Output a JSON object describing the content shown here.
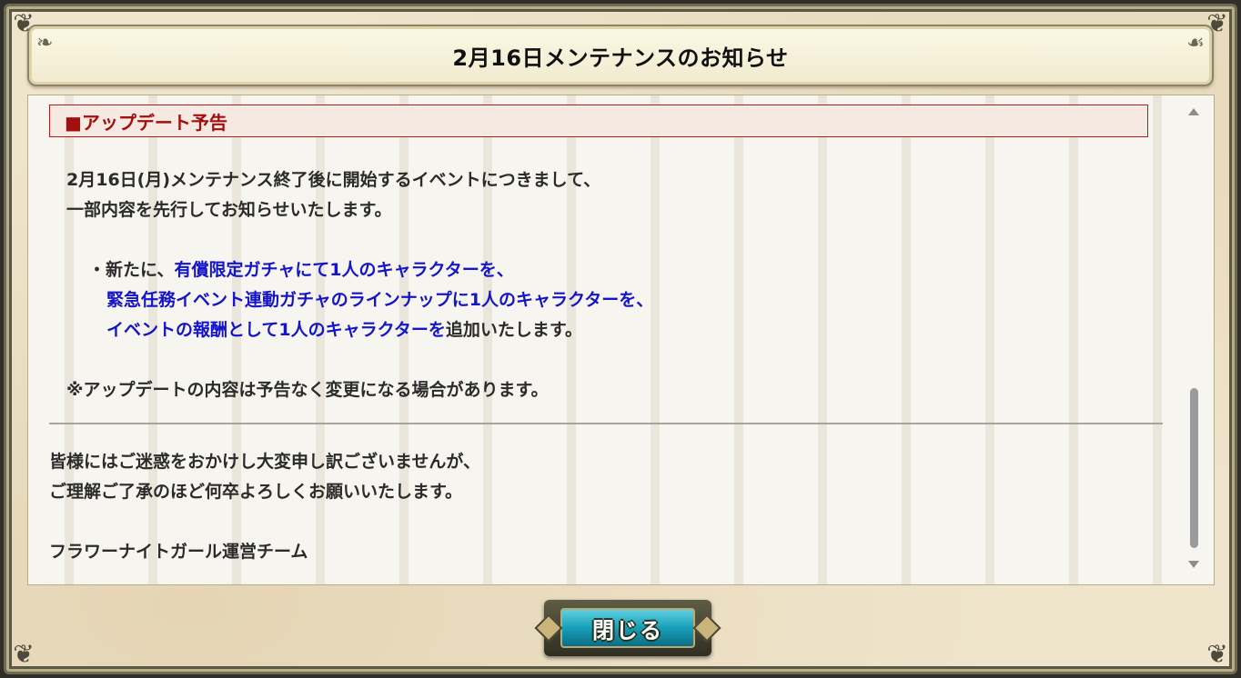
{
  "dialog": {
    "title": "2月16日メンテナンスのお知らせ",
    "section_header": "■アップデート予告",
    "intro_line1": "2月16日(月)メンテナンス終了後に開始するイベントにつきまして、",
    "intro_line2": "一部内容を先行してお知らせいたします。",
    "bullet_prefix": "・新たに、",
    "bullet_line1_blue": "有償限定ガチャにて1人のキャラクターを、",
    "bullet_line2_blue": "緊急任務イベント連動ガチャのラインナップに1人のキャラクターを、",
    "bullet_line3_blue": "イベントの報酬として1人のキャラクターを",
    "bullet_line3_suffix": "追加いたします。",
    "note": "※アップデートの内容は予告なく変更になる場合があります。",
    "apology_line1": "皆様にはご迷惑をおかけし大変申し訳ございませんが、",
    "apology_line2": "ご理解ご了承のほど何卒よろしくお願いいたします。",
    "signature": "フラワーナイトガール運営チーム",
    "close_label": "閉じる"
  },
  "colors": {
    "highlight_blue": "#1414c8",
    "section_red": "#a10f0f",
    "button_teal": "#179fb8"
  },
  "scrollbar": {
    "position_fraction": 0.9
  }
}
